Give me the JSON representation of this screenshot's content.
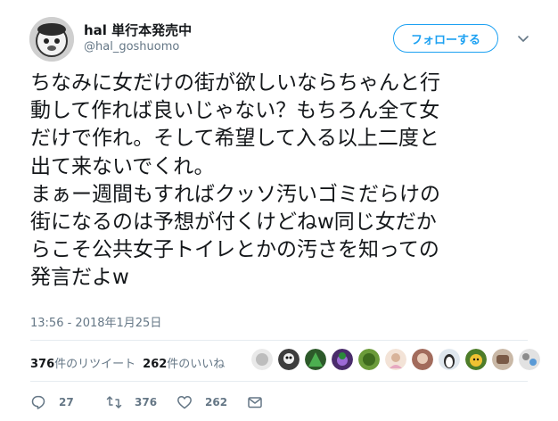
{
  "user": {
    "display_name": "hal 単行本発売中",
    "handle": "@hal_goshuomo",
    "avatar_icon": "user-avatar"
  },
  "follow_button": {
    "label": "フォローする"
  },
  "menu": {
    "icon": "chevron-down-icon"
  },
  "tweet": {
    "lines": [
      "ちなみに女だけの街が欲しいならちゃんと行",
      "動して作れば良いじゃない？もちろん全て女",
      "だけで作れ。そして希望して入る以上二度と",
      "出て来ないでくれ。",
      "まぁー週間もすればクッソ汚いゴミだらけの",
      "街になるのは予想が付くけどねw同じ女だか",
      "らこそ公共女子トイレとかの汚さを知っての",
      "発言だよw"
    ]
  },
  "timestamp": "13:56 - 2018年1月25日",
  "stats": {
    "retweets_count": "376",
    "retweets_label": "件のリツイート",
    "likes_count": "262",
    "likes_label": "件のいいね"
  },
  "actions": {
    "reply_count": "27",
    "retweet_count": "376",
    "like_count": "262"
  },
  "colors": {
    "accent": "#1da1f2",
    "text": "#14171a",
    "muted": "#657786",
    "divider": "#e6ecf0"
  }
}
